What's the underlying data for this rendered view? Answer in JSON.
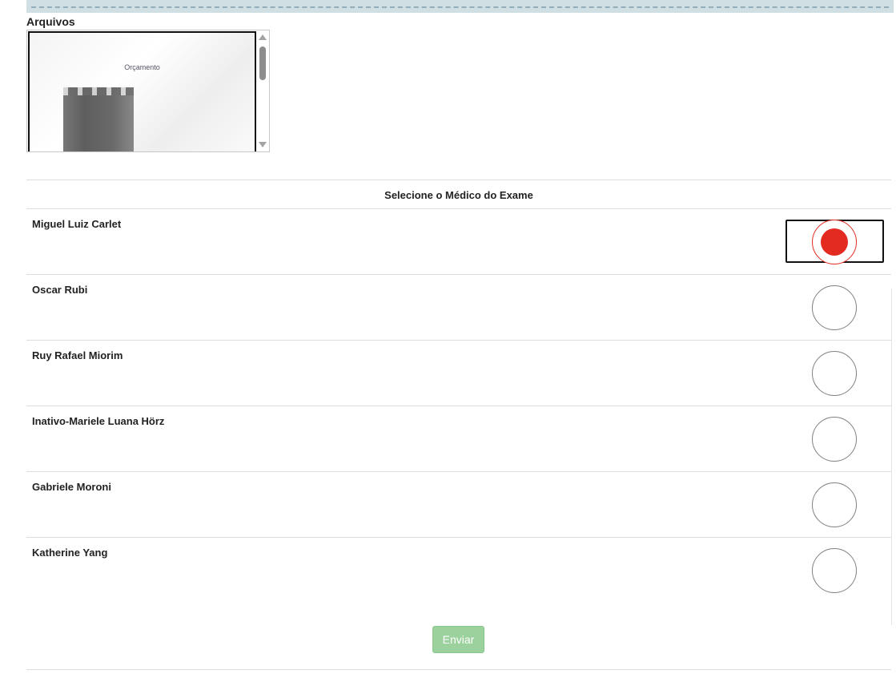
{
  "files": {
    "label": "Arquivos",
    "document": {
      "title": "Orçamento"
    }
  },
  "doctors": {
    "header": "Selecione o Médico do Exame",
    "items": [
      {
        "name": "Miguel Luiz Carlet",
        "selected": true
      },
      {
        "name": "Oscar Rubi",
        "selected": false
      },
      {
        "name": "Ruy Rafael Miorim",
        "selected": false
      },
      {
        "name": "Inativo-Mariele Luana Hörz",
        "selected": false
      },
      {
        "name": "Gabriele Moroni",
        "selected": false
      },
      {
        "name": "Katherine Yang",
        "selected": false
      }
    ]
  },
  "actions": {
    "submit_label": "Enviar"
  },
  "colors": {
    "accent_red": "#e32b22",
    "submit_green": "#9bd19c",
    "panel_blue": "#cfdfe4"
  }
}
